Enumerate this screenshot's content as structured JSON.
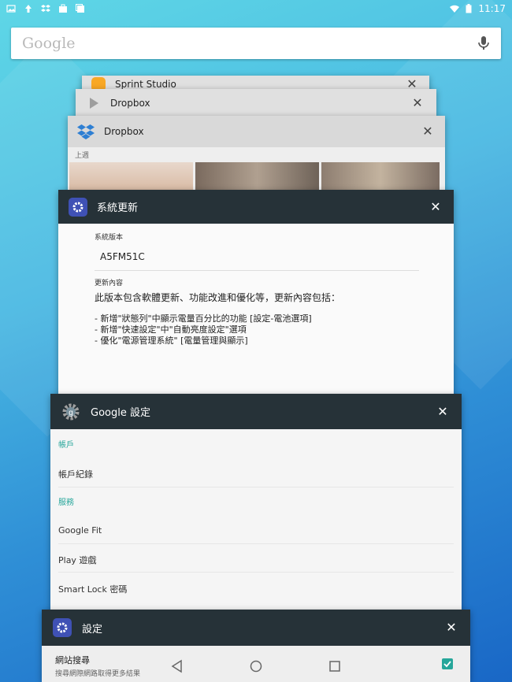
{
  "statusbar": {
    "time": "11:17"
  },
  "search": {
    "logo": "Google",
    "mic_icon": "microphone-icon"
  },
  "cards": {
    "back1": {
      "title": "Sprint Studio"
    },
    "back2": {
      "title": "Dropbox"
    },
    "dropbox": {
      "title": "Dropbox",
      "section": "上週"
    },
    "update": {
      "title": "系統更新",
      "version_label": "系統版本",
      "version": "A5FM51C",
      "content_label": "更新內容",
      "intro": "此版本包含軟體更新、功能改進和優化等，更新內容包括：",
      "items": [
        "- 新增\"狀態列\"中顯示電量百分比的功能 [設定-電池選項]",
        "- 新增\"快速設定\"中\"自動亮度設定\"選項",
        "- 優化\"電源管理系統\" [電量管理與顯示]"
      ]
    },
    "gsettings": {
      "title": "Google 設定",
      "sec1": "帳戶",
      "row1": "帳戶紀錄",
      "sec2": "服務",
      "rows": [
        "Google Fit",
        "Play 遊戲",
        "Smart Lock 密碼"
      ]
    },
    "settings": {
      "title": "設定",
      "row_title": "網站搜尋",
      "row_sub": "搜尋網際網路取得更多結果"
    }
  },
  "colors": {
    "accent": "#26a69a",
    "dark_header": "#263238",
    "settings_icon_bg": "#3f51b5"
  }
}
